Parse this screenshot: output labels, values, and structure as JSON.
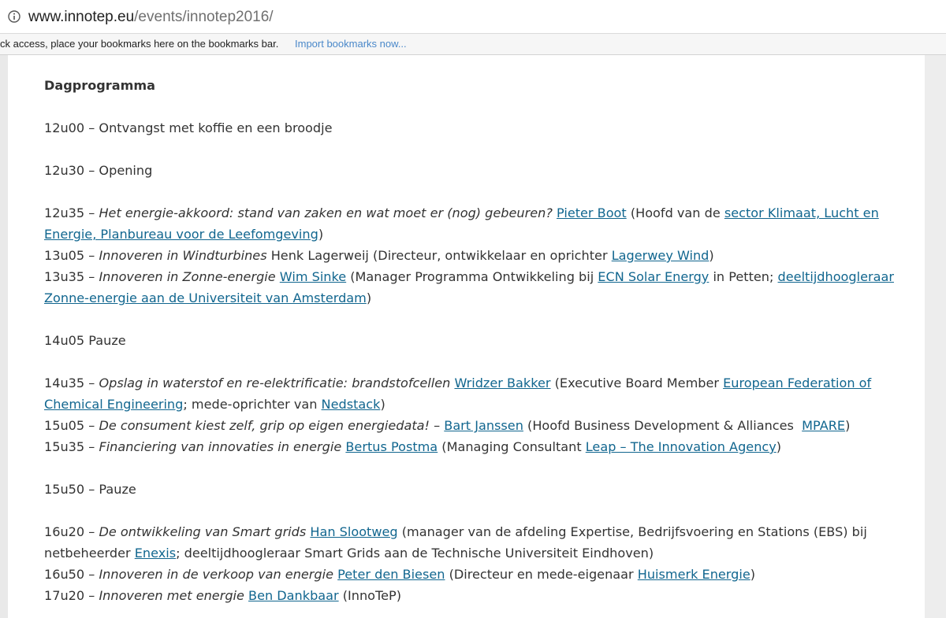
{
  "browser": {
    "url_host": "www.innotep.eu",
    "url_path": "/events/innotep2016/",
    "bookmarks_message": "ck access, place your bookmarks here on the bookmarks bar.",
    "import_bookmarks": "Import bookmarks now..."
  },
  "program": {
    "heading": "Dagprogramma",
    "item_0": "12u00 – Ontvangst met koffie en een broodje",
    "item_1": "12u30 – Opening",
    "s2_time": "12u35 – ",
    "s2_title": "Het energie-akkoord: stand van zaken en wat moet er (nog) gebeuren?",
    "s2_speaker": "Pieter Boot",
    "s2_mid": " (Hoofd van de ",
    "s2_org": "sector Klimaat, Lucht en Energie, Planbureau voor de Leefomgeving",
    "s3_time": "13u05 – ",
    "s3_title": "Innoveren in Windturbines",
    "s3_text": " Henk Lagerweij (Directeur, ontwikkelaar en oprichter ",
    "s3_org": "Lagerwey Wind",
    "s4_time": "13u35 – ",
    "s4_title": "Innoveren in Zonne-energie",
    "s4_speaker": "Wim Sinke",
    "s4_mid": " (Manager Programma Ontwikkeling bij ",
    "s4_org": "ECN Solar Energy",
    "s4_mid2": " in Petten; ",
    "s4_org2": "deeltijdhoogleraar Zonne-energie aan de Universiteit van Amsterdam",
    "pauze1": "14u05 Pauze",
    "s5_time": "14u35 – ",
    "s5_title": "Opslag in waterstof en re-elektrificatie: brandstofcellen",
    "s5_speaker": "Wridzer Bakker",
    "s5_mid": " (Executive Board Member ",
    "s5_org": "European Federation of Chemical Engineering",
    "s5_mid2": "; mede-oprichter van ",
    "s5_org2": "Nedstack",
    "s6_time": "15u05 – ",
    "s6_title": "De consument kiest zelf, grip op eigen energiedata!",
    "s6_dash": " – ",
    "s6_speaker": "Bart Janssen",
    "s6_mid": " (Hoofd Business Development & Alliances  ",
    "s6_org": "MPARE",
    "s7_time": "15u35 – ",
    "s7_title": "Financiering van innovaties in energie",
    "s7_speaker": "Bertus Postma",
    "s7_mid": " (Managing Consultant ",
    "s7_org": "Leap – The Innovation Agency",
    "pauze2": "15u50 – Pauze",
    "s8_time": "16u20 – ",
    "s8_title": "De ontwikkeling van Smart grids",
    "s8_speaker": "Han Slootweg",
    "s8_mid": " (manager van de afdeling Expertise, Bedrijfsvoering en Stations (EBS) bij netbeheerder ",
    "s8_org": "Enexis",
    "s8_rest": "; deeltijdhoogleraar Smart Grids aan de Technische Universiteit Eindhoven)",
    "s9_time": "16u50 – ",
    "s9_title": "Innoveren in de verkoop van energie",
    "s9_speaker": "Peter den Biesen",
    "s9_mid": " (Directeur en mede-eigenaar ",
    "s9_org": "Huismerk Energie",
    "s10_time": "17u20 – ",
    "s10_title": "Innoveren met energie",
    "s10_speaker": "Ben Dankbaar",
    "s10_rest": " (InnoTeP)"
  }
}
